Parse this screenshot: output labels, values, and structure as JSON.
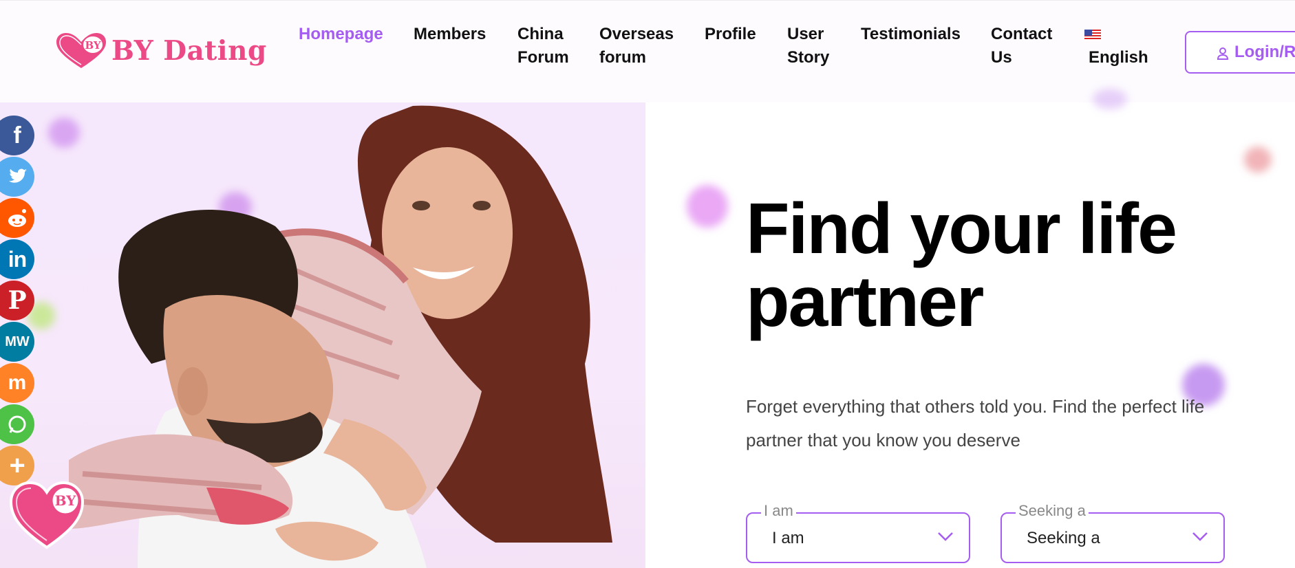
{
  "header": {
    "logo_text": "BY Dating",
    "logo_badge": "BY",
    "nav": [
      {
        "label": "Homepage",
        "active": true
      },
      {
        "label": "Members"
      },
      {
        "label": "China\nForum"
      },
      {
        "label": "Overseas\nforum"
      },
      {
        "label": "Profile"
      },
      {
        "label": "User\nStory"
      },
      {
        "label": "Testimonials"
      },
      {
        "label": "Contact\nUs"
      }
    ],
    "language": "English",
    "language_flag": "us-flag-icon",
    "login_label": "Login/Register"
  },
  "share_bar": [
    {
      "name": "facebook",
      "icon": "facebook-icon",
      "color": "#3b5998"
    },
    {
      "name": "twitter",
      "icon": "twitter-icon",
      "color": "#55acee"
    },
    {
      "name": "reddit",
      "icon": "reddit-icon",
      "color": "#ff5700"
    },
    {
      "name": "linkedin",
      "icon": "linkedin-icon",
      "color": "#0077b5"
    },
    {
      "name": "pinterest",
      "icon": "pinterest-icon",
      "color": "#cb2027"
    },
    {
      "name": "mewe",
      "icon": "mewe-icon",
      "color": "#007da1"
    },
    {
      "name": "mix",
      "icon": "mix-icon",
      "color": "#ff8226"
    },
    {
      "name": "whatsapp",
      "icon": "whatsapp-icon",
      "color": "#4dc247"
    },
    {
      "name": "more",
      "icon": "plus-icon",
      "color": "#f0a04b"
    }
  ],
  "hero": {
    "title_part1": "Find your ",
    "title_highlight": "life",
    "title_part2": "partner",
    "subtitle": "Forget everything that others told you. Find the perfect life partner that you know you deserve",
    "select_i_am": {
      "legend": "I am",
      "value": "I am"
    },
    "select_seeking": {
      "legend": "Seeking a",
      "value": "Seeking a"
    }
  },
  "colors": {
    "accent": "#a55cf0",
    "brand_pink": "#ec4a86",
    "highlight_green": "#8fd448",
    "highlight_teal": "#4fd6b8"
  }
}
